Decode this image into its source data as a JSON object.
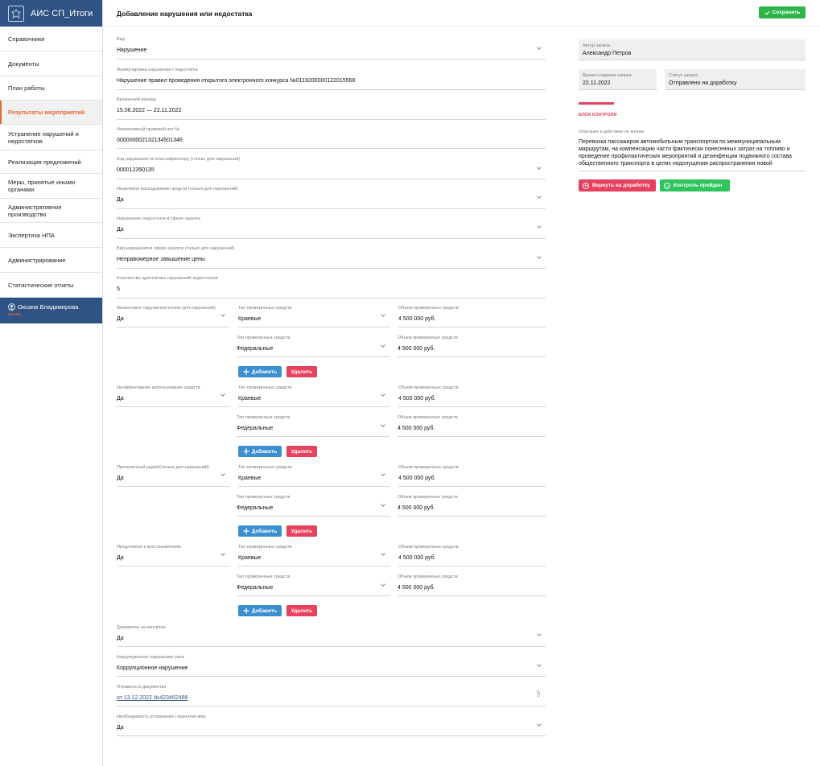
{
  "app": {
    "title": "АИС СП_Итоги"
  },
  "sidebar": {
    "items": [
      {
        "label": "Справочники"
      },
      {
        "label": "Документы"
      },
      {
        "label": "План работы"
      },
      {
        "label": "Результаты мероприятий",
        "active": true
      },
      {
        "label": "Устранение нарушений и недостатков"
      },
      {
        "label": "Реализация предложений"
      },
      {
        "label": "Меры, принятые иными органами"
      },
      {
        "label": "Административное производство"
      },
      {
        "label": "Экспертиза НПА"
      },
      {
        "label": "Администрирование"
      },
      {
        "label": "Статистические отчеты"
      }
    ],
    "user": {
      "name": "Оксана Владимирова",
      "exit": "выход"
    }
  },
  "header": {
    "title": "Добавление нарушения или недостатка",
    "save_label": "Сохранить"
  },
  "form": {
    "vid": {
      "label": "Вид",
      "value": "Нарушение"
    },
    "formulation": {
      "label": "Формулировка нарушения / недостатка",
      "value": "Нарушение правил проведения открытого электронного конкурса №0119200000122015568"
    },
    "period": {
      "label": "Временной период",
      "value": "15.06.2022 — 22.11.2022"
    },
    "npa": {
      "label": "Нормативный правовой акт №",
      "value": "000000002132134501346"
    },
    "code": {
      "label": "Код нарушения по классификатору (только для нарушений)",
      "value": "000012350135"
    },
    "misuse": {
      "label": "Нецелевое расходование средств (только для нарушений)",
      "value": "Да"
    },
    "procurement": {
      "label": "Нарушение/ недостаток в сфере закупок",
      "value": "Да"
    },
    "procurement_type": {
      "label": "Вид нарушения в сфере закупок (только для нарушений)",
      "value": "Неправомерное завышение цены"
    },
    "count": {
      "label": "Количество однотипных нарушений/ недостатков",
      "value": "5"
    },
    "groups": [
      {
        "label": "Финансовое нарушение(только для нарушений)",
        "value": "Да",
        "rows": [
          {
            "type_label": "Тип проверенных средств",
            "type_value": "Краевые",
            "amount_label": "Объем проверенных средств",
            "amount_value": "4 500 000 руб."
          },
          {
            "type_label": "Тип проверенных средств",
            "type_value": "Федеральные",
            "amount_label": "Объем проверенных средств",
            "amount_value": "4 500 000 руб."
          }
        ],
        "add_label": "Добавить",
        "del_label": "Удалить"
      },
      {
        "label": "Неэффективное использование средств",
        "value": "Да",
        "rows": [
          {
            "type_label": "Тип проверенных средств",
            "type_value": "Краевые",
            "amount_label": "Объем проверенных средств",
            "amount_value": "4 500 000 руб."
          },
          {
            "type_label": "Тип проверенных средств",
            "type_value": "Федеральные",
            "amount_label": "Объем проверенных средств",
            "amount_value": "4 500 000 руб."
          }
        ],
        "add_label": "Добавить",
        "del_label": "Удалить"
      },
      {
        "label": "Причиненный ущерб(только для нарушений)",
        "value": "Да",
        "rows": [
          {
            "type_label": "Тип проверенных средств",
            "type_value": "Краевые",
            "amount_label": "Объем проверенных средств",
            "amount_value": "4 500 000 руб."
          },
          {
            "type_label": "Тип проверенных средств",
            "type_value": "Федеральные",
            "amount_label": "Объем проверенных средств",
            "amount_value": "4 500 000 руб."
          }
        ],
        "add_label": "Добавить",
        "del_label": "Удалить"
      },
      {
        "label": "Предложено к восстановлению",
        "value": "Да",
        "rows": [
          {
            "type_label": "Тип проверенных средств",
            "type_value": "Краевые",
            "amount_label": "Объем проверенных средств",
            "amount_value": "4 500 000 руб."
          },
          {
            "type_label": "Тип проверенных средств",
            "type_value": "Федеральные",
            "amount_label": "Объем проверенных средств",
            "amount_value": "4 500 000 руб."
          }
        ],
        "add_label": "Добавить",
        "del_label": "Удалить"
      }
    ],
    "docs_control": {
      "label": "Документы на контроле",
      "value": "Да"
    },
    "corruption": {
      "label": "Коррупционное нарушение/ риск",
      "value": "Коррупционное нарушение"
    },
    "reflected": {
      "label": "Отражено в документах",
      "value": "от 13.12.2022 №423462466"
    },
    "necessity": {
      "label": "Необходимость устранения / принятия мер",
      "value": "Да"
    }
  },
  "panel": {
    "author": {
      "label": "Автор записи",
      "value": "Александр Петров"
    },
    "created": {
      "label": "Время создания записи",
      "value": "22.11.2022"
    },
    "status": {
      "label": "Статус записи",
      "value": "Отправлено на доработку"
    },
    "control_title": "БЛОК КОНТРОЛЯ",
    "description_label": "Описание к действию по кнопке",
    "description": "Перевозки пассажиров автомобильным транспортом по межмуниципальным маршрутам, на компенсацию части фактически понесенных затрат на топливо и проведение профилактических мероприятий и дезинфекции подвижного состава общественного транспорта в целях недопущения распространения новой",
    "return_label": "Вернуть на доработку",
    "pass_label": "Контроль пройден"
  }
}
